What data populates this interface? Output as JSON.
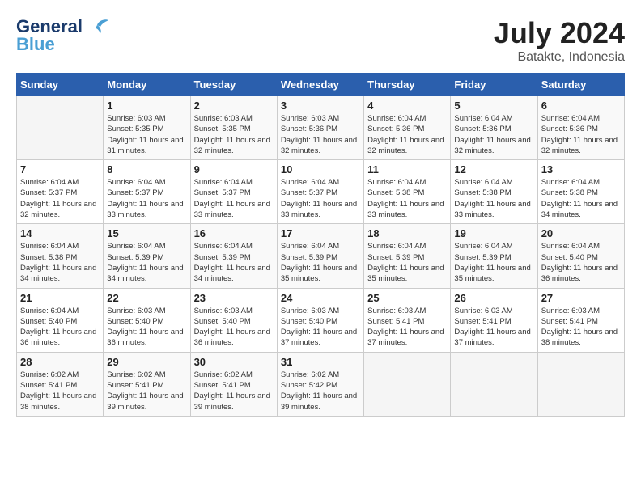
{
  "header": {
    "logo_line1": "General",
    "logo_line2": "Blue",
    "month_year": "July 2024",
    "location": "Batakte, Indonesia"
  },
  "calendar": {
    "days_of_week": [
      "Sunday",
      "Monday",
      "Tuesday",
      "Wednesday",
      "Thursday",
      "Friday",
      "Saturday"
    ],
    "weeks": [
      [
        {
          "day": "",
          "info": ""
        },
        {
          "day": "1",
          "info": "Sunrise: 6:03 AM\nSunset: 5:35 PM\nDaylight: 11 hours and 31 minutes."
        },
        {
          "day": "2",
          "info": "Sunrise: 6:03 AM\nSunset: 5:35 PM\nDaylight: 11 hours and 32 minutes."
        },
        {
          "day": "3",
          "info": "Sunrise: 6:03 AM\nSunset: 5:36 PM\nDaylight: 11 hours and 32 minutes."
        },
        {
          "day": "4",
          "info": "Sunrise: 6:04 AM\nSunset: 5:36 PM\nDaylight: 11 hours and 32 minutes."
        },
        {
          "day": "5",
          "info": "Sunrise: 6:04 AM\nSunset: 5:36 PM\nDaylight: 11 hours and 32 minutes."
        },
        {
          "day": "6",
          "info": "Sunrise: 6:04 AM\nSunset: 5:36 PM\nDaylight: 11 hours and 32 minutes."
        }
      ],
      [
        {
          "day": "7",
          "info": "Sunrise: 6:04 AM\nSunset: 5:37 PM\nDaylight: 11 hours and 32 minutes."
        },
        {
          "day": "8",
          "info": "Sunrise: 6:04 AM\nSunset: 5:37 PM\nDaylight: 11 hours and 33 minutes."
        },
        {
          "day": "9",
          "info": "Sunrise: 6:04 AM\nSunset: 5:37 PM\nDaylight: 11 hours and 33 minutes."
        },
        {
          "day": "10",
          "info": "Sunrise: 6:04 AM\nSunset: 5:37 PM\nDaylight: 11 hours and 33 minutes."
        },
        {
          "day": "11",
          "info": "Sunrise: 6:04 AM\nSunset: 5:38 PM\nDaylight: 11 hours and 33 minutes."
        },
        {
          "day": "12",
          "info": "Sunrise: 6:04 AM\nSunset: 5:38 PM\nDaylight: 11 hours and 33 minutes."
        },
        {
          "day": "13",
          "info": "Sunrise: 6:04 AM\nSunset: 5:38 PM\nDaylight: 11 hours and 34 minutes."
        }
      ],
      [
        {
          "day": "14",
          "info": "Sunrise: 6:04 AM\nSunset: 5:38 PM\nDaylight: 11 hours and 34 minutes."
        },
        {
          "day": "15",
          "info": "Sunrise: 6:04 AM\nSunset: 5:39 PM\nDaylight: 11 hours and 34 minutes."
        },
        {
          "day": "16",
          "info": "Sunrise: 6:04 AM\nSunset: 5:39 PM\nDaylight: 11 hours and 34 minutes."
        },
        {
          "day": "17",
          "info": "Sunrise: 6:04 AM\nSunset: 5:39 PM\nDaylight: 11 hours and 35 minutes."
        },
        {
          "day": "18",
          "info": "Sunrise: 6:04 AM\nSunset: 5:39 PM\nDaylight: 11 hours and 35 minutes."
        },
        {
          "day": "19",
          "info": "Sunrise: 6:04 AM\nSunset: 5:39 PM\nDaylight: 11 hours and 35 minutes."
        },
        {
          "day": "20",
          "info": "Sunrise: 6:04 AM\nSunset: 5:40 PM\nDaylight: 11 hours and 36 minutes."
        }
      ],
      [
        {
          "day": "21",
          "info": "Sunrise: 6:04 AM\nSunset: 5:40 PM\nDaylight: 11 hours and 36 minutes."
        },
        {
          "day": "22",
          "info": "Sunrise: 6:03 AM\nSunset: 5:40 PM\nDaylight: 11 hours and 36 minutes."
        },
        {
          "day": "23",
          "info": "Sunrise: 6:03 AM\nSunset: 5:40 PM\nDaylight: 11 hours and 36 minutes."
        },
        {
          "day": "24",
          "info": "Sunrise: 6:03 AM\nSunset: 5:40 PM\nDaylight: 11 hours and 37 minutes."
        },
        {
          "day": "25",
          "info": "Sunrise: 6:03 AM\nSunset: 5:41 PM\nDaylight: 11 hours and 37 minutes."
        },
        {
          "day": "26",
          "info": "Sunrise: 6:03 AM\nSunset: 5:41 PM\nDaylight: 11 hours and 37 minutes."
        },
        {
          "day": "27",
          "info": "Sunrise: 6:03 AM\nSunset: 5:41 PM\nDaylight: 11 hours and 38 minutes."
        }
      ],
      [
        {
          "day": "28",
          "info": "Sunrise: 6:02 AM\nSunset: 5:41 PM\nDaylight: 11 hours and 38 minutes."
        },
        {
          "day": "29",
          "info": "Sunrise: 6:02 AM\nSunset: 5:41 PM\nDaylight: 11 hours and 39 minutes."
        },
        {
          "day": "30",
          "info": "Sunrise: 6:02 AM\nSunset: 5:41 PM\nDaylight: 11 hours and 39 minutes."
        },
        {
          "day": "31",
          "info": "Sunrise: 6:02 AM\nSunset: 5:42 PM\nDaylight: 11 hours and 39 minutes."
        },
        {
          "day": "",
          "info": ""
        },
        {
          "day": "",
          "info": ""
        },
        {
          "day": "",
          "info": ""
        }
      ]
    ]
  }
}
